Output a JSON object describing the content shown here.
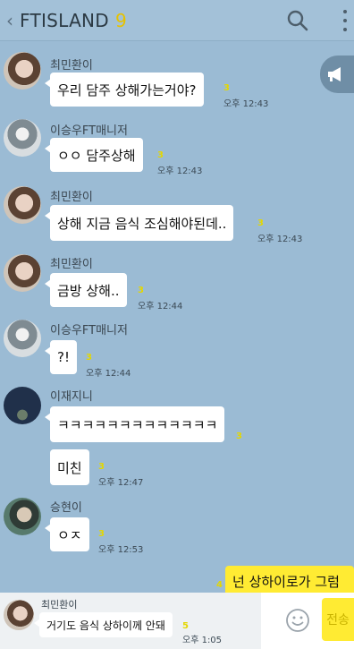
{
  "header": {
    "back_icon": "chevron-left-icon",
    "title": "FTISLAND",
    "member_count": "9",
    "search_icon": "search-icon",
    "more_icon": "more-vertical-icon"
  },
  "notice_icon": "megaphone-icon",
  "messages": [
    {
      "sender": "최민환이",
      "text": "우리 담주 상해가는거야?",
      "unread": "3",
      "time": "오후 12:43"
    },
    {
      "sender": "이승우FT매니저",
      "text": "ㅇㅇ 담주상해",
      "unread": "3",
      "time": "오후 12:43"
    },
    {
      "sender": "최민환이",
      "text": "상해 지금 음식 조심해야된데..",
      "unread": "3",
      "time": "오후 12:43"
    },
    {
      "sender": "최민환이",
      "text": "금방 상해..",
      "unread": "3",
      "time": "오후 12:44"
    },
    {
      "sender": "이승우FT매니저",
      "text": "?!",
      "unread": "3",
      "time": "오후 12:44"
    },
    {
      "sender": "이재지니",
      "text": "ㅋㅋㅋㅋㅋㅋㅋㅋㅋㅋㅋㅋㅋ",
      "unread": "3",
      "time": ""
    },
    {
      "sender": "",
      "text": "미친",
      "unread": "3",
      "time": "오후 12:47"
    },
    {
      "sender": "승현이",
      "text": "ㅇㅈ",
      "unread": "3",
      "time": "오후 12:53"
    }
  ],
  "my_message": {
    "text": "넌 상하이로가 그럼",
    "unread": "4"
  },
  "preview": {
    "sender": "최민환이",
    "text": "거기도 음식 상하이께 안돼",
    "unread": "5",
    "time": "오후 1:05"
  },
  "input": {
    "emoji_icon": "smiley-icon",
    "send_label": "전송"
  },
  "colors": {
    "background": "#9bbbd4",
    "my_bubble": "#ffeb33",
    "unread": "#e4d700"
  }
}
